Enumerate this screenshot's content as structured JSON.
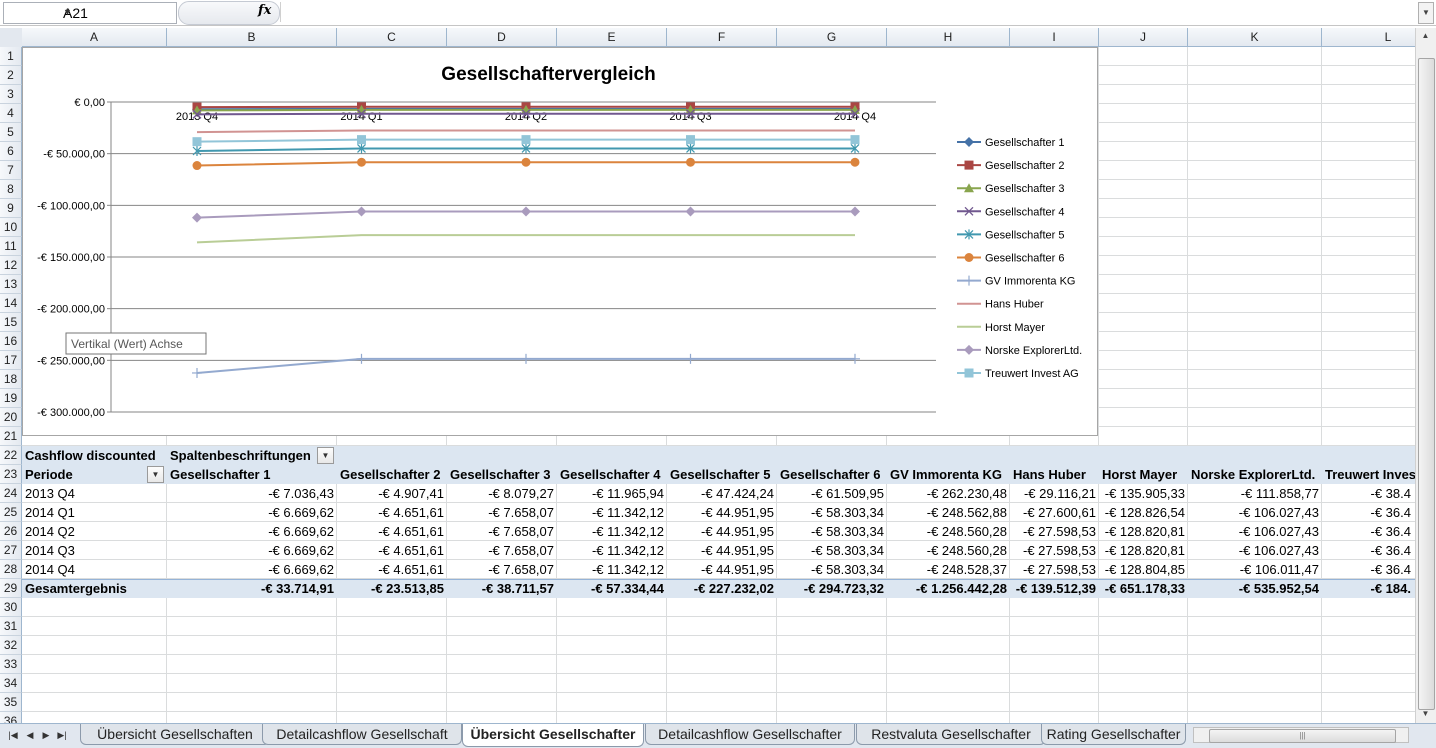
{
  "formula_bar": {
    "name_box": "A21",
    "fx_label": "fx",
    "formula": ""
  },
  "columns": [
    "A",
    "B",
    "C",
    "D",
    "E",
    "F",
    "G",
    "H",
    "I",
    "J",
    "K",
    "L"
  ],
  "rows": [
    "1",
    "2",
    "3",
    "4",
    "5",
    "6",
    "7",
    "8",
    "9",
    "10",
    "11",
    "12",
    "13",
    "14",
    "15",
    "16",
    "17",
    "18",
    "19",
    "20",
    "21",
    "22",
    "23",
    "24",
    "25",
    "26",
    "27",
    "28",
    "29",
    "30",
    "31",
    "32",
    "33",
    "34",
    "35",
    "36"
  ],
  "chart_data": {
    "type": "line",
    "title": "Gesellschaftervergleich",
    "categories": [
      "2013 Q4",
      "2014 Q1",
      "2014 Q2",
      "2014 Q3",
      "2014 Q4"
    ],
    "ylim": [
      -300000,
      0
    ],
    "yticks": [
      "€ 0,00",
      "-€ 50.000,00",
      "-€ 100.000,00",
      "-€ 150.000,00",
      "-€ 200.000,00",
      "-€ 250.000,00",
      "-€ 300.000,00"
    ],
    "grid": true,
    "legend_position": "right",
    "tooltip": "Vertikal (Wert) Achse",
    "series": [
      {
        "name": "Gesellschafter 1",
        "color": "#4572a7",
        "marker": "diamond",
        "values": [
          -7036.43,
          -6669.62,
          -6669.62,
          -6669.62,
          -6669.62
        ]
      },
      {
        "name": "Gesellschafter 2",
        "color": "#aa4643",
        "marker": "square",
        "values": [
          -4907.41,
          -4651.61,
          -4651.61,
          -4651.61,
          -4651.61
        ]
      },
      {
        "name": "Gesellschafter 3",
        "color": "#89a54e",
        "marker": "triangle",
        "values": [
          -8079.27,
          -7658.07,
          -7658.07,
          -7658.07,
          -7658.07
        ]
      },
      {
        "name": "Gesellschafter 4",
        "color": "#71588f",
        "marker": "x",
        "values": [
          -11965.94,
          -11342.12,
          -11342.12,
          -11342.12,
          -11342.12
        ]
      },
      {
        "name": "Gesellschafter 5",
        "color": "#4198af",
        "marker": "star",
        "values": [
          -47424.24,
          -44951.95,
          -44951.95,
          -44951.95,
          -44951.95
        ]
      },
      {
        "name": "Gesellschafter 6",
        "color": "#db843d",
        "marker": "circle",
        "values": [
          -61509.95,
          -58303.34,
          -58303.34,
          -58303.34,
          -58303.34
        ]
      },
      {
        "name": "GV Immorenta KG",
        "color": "#93a9cf",
        "marker": "plus",
        "values": [
          -262230.48,
          -248562.88,
          -248560.28,
          -248560.28,
          -248528.37
        ]
      },
      {
        "name": "Hans Huber",
        "color": "#d19392",
        "marker": "none",
        "values": [
          -29116.21,
          -27600.61,
          -27598.53,
          -27598.53,
          -27598.53
        ]
      },
      {
        "name": "Horst Mayer",
        "color": "#b9cd96",
        "marker": "none",
        "values": [
          -135905.33,
          -128826.54,
          -128820.81,
          -128820.81,
          -128804.85
        ]
      },
      {
        "name": "Norske ExplorerLtd.",
        "color": "#a99bbd",
        "marker": "diamond",
        "values": [
          -111858.77,
          -106027.43,
          -106027.43,
          -106027.43,
          -106011.47
        ]
      },
      {
        "name": "Treuwert Invest AG",
        "color": "#92c5d8",
        "marker": "square",
        "values": [
          -38400,
          -36400,
          -36400,
          -36400,
          -36400
        ]
      }
    ]
  },
  "pivot": {
    "value_label": "Cashflow discounted",
    "column_labels": "Spaltenbeschriftungen",
    "row_header": "Periode",
    "headers": [
      "Gesellschafter 1",
      "Gesellschafter 2",
      "Gesellschafter 3",
      "Gesellschafter 4",
      "Gesellschafter 5",
      "Gesellschafter 6",
      "GV Immorenta KG",
      "Hans Huber",
      "Horst Mayer",
      "Norske ExplorerLtd.",
      "Treuwert Invest"
    ],
    "rows": [
      {
        "label": "2013 Q4",
        "values": [
          "-€ 7.036,43",
          "-€ 4.907,41",
          "-€ 8.079,27",
          "-€ 11.965,94",
          "-€ 47.424,24",
          "-€ 61.509,95",
          "-€ 262.230,48",
          "-€ 29.116,21",
          "-€ 135.905,33",
          "-€ 111.858,77",
          "-€ 38.4"
        ]
      },
      {
        "label": "2014 Q1",
        "values": [
          "-€ 6.669,62",
          "-€ 4.651,61",
          "-€ 7.658,07",
          "-€ 11.342,12",
          "-€ 44.951,95",
          "-€ 58.303,34",
          "-€ 248.562,88",
          "-€ 27.600,61",
          "-€ 128.826,54",
          "-€ 106.027,43",
          "-€ 36.4"
        ]
      },
      {
        "label": "2014 Q2",
        "values": [
          "-€ 6.669,62",
          "-€ 4.651,61",
          "-€ 7.658,07",
          "-€ 11.342,12",
          "-€ 44.951,95",
          "-€ 58.303,34",
          "-€ 248.560,28",
          "-€ 27.598,53",
          "-€ 128.820,81",
          "-€ 106.027,43",
          "-€ 36.4"
        ]
      },
      {
        "label": "2014 Q3",
        "values": [
          "-€ 6.669,62",
          "-€ 4.651,61",
          "-€ 7.658,07",
          "-€ 11.342,12",
          "-€ 44.951,95",
          "-€ 58.303,34",
          "-€ 248.560,28",
          "-€ 27.598,53",
          "-€ 128.820,81",
          "-€ 106.027,43",
          "-€ 36.4"
        ]
      },
      {
        "label": "2014 Q4",
        "values": [
          "-€ 6.669,62",
          "-€ 4.651,61",
          "-€ 7.658,07",
          "-€ 11.342,12",
          "-€ 44.951,95",
          "-€ 58.303,34",
          "-€ 248.528,37",
          "-€ 27.598,53",
          "-€ 128.804,85",
          "-€ 106.011,47",
          "-€ 36.4"
        ]
      }
    ],
    "total": {
      "label": "Gesamtergebnis",
      "values": [
        "-€ 33.714,91",
        "-€ 23.513,85",
        "-€ 38.711,57",
        "-€ 57.334,44",
        "-€ 227.232,02",
        "-€ 294.723,32",
        "-€ 1.256.442,28",
        "-€ 139.512,39",
        "-€ 651.178,33",
        "-€ 535.952,54",
        "-€ 184."
      ]
    }
  },
  "sheet_tabs": [
    "Übersicht Gesellschaften",
    "Detailcashflow Gesellschaft",
    "Übersicht Gesellschafter",
    "Detailcashflow Gesellschafter",
    "Restvaluta Gesellschafter",
    "Rating Gesellschafter"
  ],
  "active_tab_index": 2
}
